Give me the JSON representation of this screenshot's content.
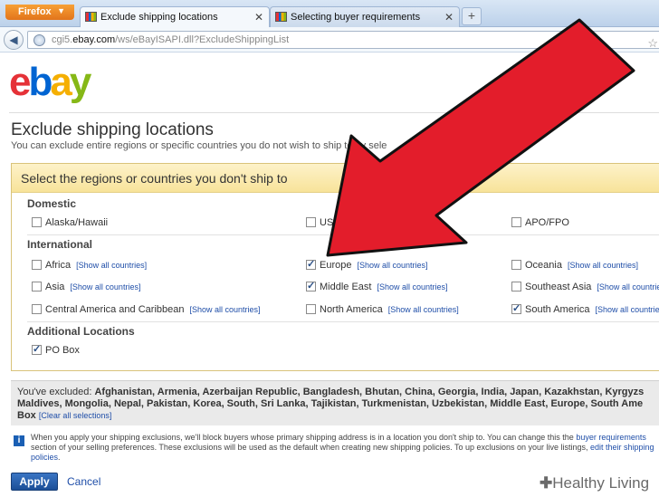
{
  "browser": {
    "menu_label": "Firefox",
    "tabs": [
      {
        "label": "Exclude shipping locations"
      },
      {
        "label": "Selecting buyer requirements"
      }
    ],
    "url_prefix": "cgi5.",
    "url_domain": "ebay.com",
    "url_path": "/ws/eBayISAPI.dll?ExcludeShippingList"
  },
  "logo": {
    "e": "e",
    "b": "b",
    "a": "a",
    "y": "y"
  },
  "page": {
    "title": "Exclude shipping locations",
    "subtitle": "You can exclude entire regions or specific countries you do not wish to ship to by sele"
  },
  "panel": {
    "heading": "Select the regions or countries you don't ship to",
    "show_all": "[Show all countries]",
    "groups": {
      "domestic": "Domestic",
      "international": "International",
      "additional": "Additional Locations"
    },
    "domestic": [
      {
        "label": "Alaska/Hawaii",
        "checked": false
      },
      {
        "label": "US P",
        "checked": false
      },
      {
        "label": "APO/FPO",
        "checked": false
      }
    ],
    "international": [
      {
        "label": "Africa",
        "checked": false
      },
      {
        "label": "Europe",
        "checked": true
      },
      {
        "label": "Oceania",
        "checked": false
      },
      {
        "label": "Asia",
        "checked": false
      },
      {
        "label": "Middle East",
        "checked": true
      },
      {
        "label": "Southeast Asia",
        "checked": false
      },
      {
        "label": "Central America and Caribbean",
        "checked": false
      },
      {
        "label": "North America",
        "checked": false
      },
      {
        "label": "South America",
        "checked": true
      }
    ],
    "additional": [
      {
        "label": "PO Box",
        "checked": true
      }
    ]
  },
  "excluded": {
    "prefix": "You've excluded: ",
    "list": "Afghanistan, Armenia, Azerbaijan Republic, Bangladesh, Bhutan, China, Georgia, India, Japan, Kazakhstan, Kyrgyzs Maldives, Mongolia, Nepal, Pakistan, Korea, South, Sri Lanka, Tajikistan, Turkmenistan, Uzbekistan, Middle East, Europe, South Ame Box",
    "clear_label": "[Clear all selections]"
  },
  "info": {
    "text1": "When you apply your shipping exclusions, we'll block buyers whose primary shipping address is in a location you don't ship to. You can change this the",
    "link1": "buyer requirements",
    "text2": " section of your selling preferences. These exclusions will be used as the default when creating new shipping policies. To up exclusions on your live listings, ",
    "link2": "edit their shipping policies",
    "text3": "."
  },
  "actions": {
    "apply": "Apply",
    "cancel": "Cancel"
  },
  "watermark": {
    "plus": "✚",
    "text": "Healthy Living"
  },
  "colors": {
    "arrow": "#e31d2b",
    "arrow_outline": "#111111",
    "ebay_red": "#e53238",
    "ebay_blue": "#0064d2",
    "ebay_yellow": "#f5af02",
    "ebay_green": "#86b817"
  }
}
